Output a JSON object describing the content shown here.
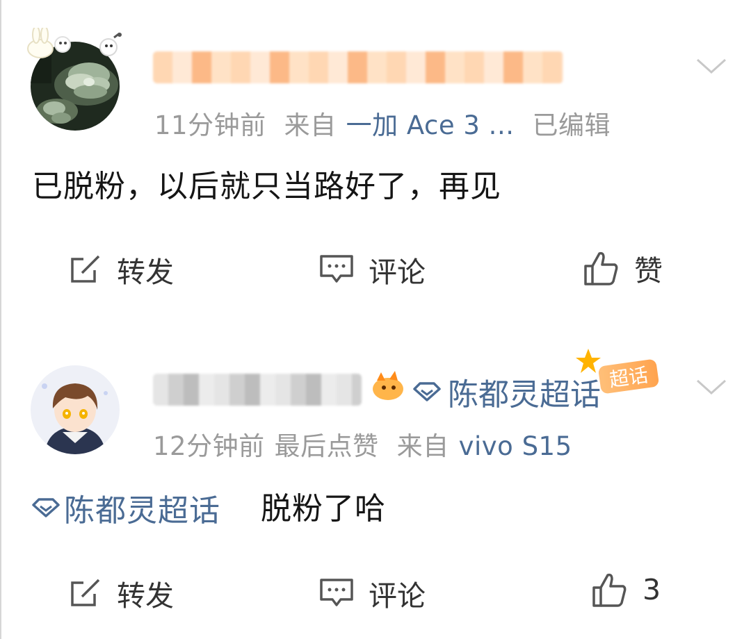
{
  "post1": {
    "meta": {
      "time": "11分钟前",
      "source_prefix": "来自",
      "device": "一加 Ace 3 ...",
      "edited": "已编辑"
    },
    "content": "已脱粉，以后就只当路好了，再见",
    "actions": {
      "repost": "转发",
      "comment": "评论",
      "like": "赞"
    }
  },
  "post2": {
    "supertopic_link": "陈都灵超话",
    "badge": "超话",
    "meta": {
      "time": "12分钟前",
      "last_like": "最后点赞",
      "source_prefix": "来自",
      "device": "vivo S15"
    },
    "content_topic": "陈都灵超话",
    "content": "脱粉了哈",
    "actions": {
      "repost": "转发",
      "comment": "评论",
      "like_count": "3"
    }
  },
  "colors": {
    "link": "#4a6b94",
    "meta": "#9a9a9a",
    "text": "#151515",
    "badge": "#ff9a3c"
  },
  "icons": {
    "repost": "repost-icon",
    "comment": "comment-icon",
    "like": "thumbs-up-icon",
    "more": "chevron-down-icon",
    "supertopic": "diamond-icon"
  }
}
